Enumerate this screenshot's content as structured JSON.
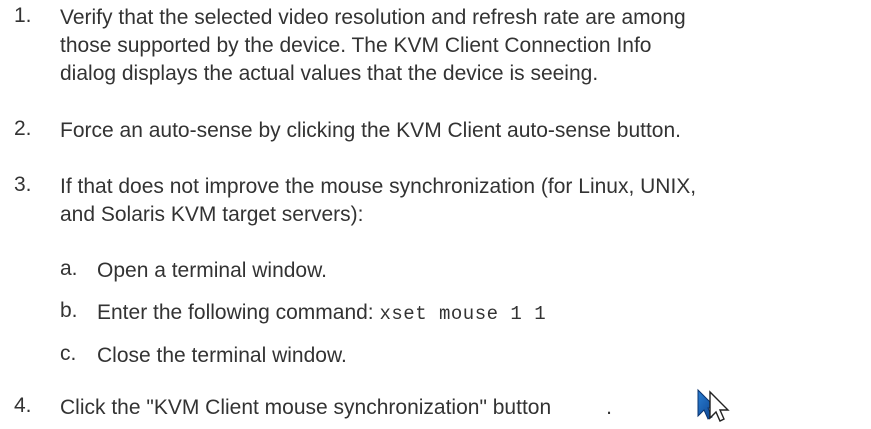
{
  "steps": [
    {
      "number": "1.",
      "lines": [
        "Verify that the selected video resolution and refresh rate are among",
        "those supported by the device. The KVM Client Connection Info",
        "dialog displays the actual values that the device is seeing."
      ]
    },
    {
      "number": "2.",
      "lines": [
        "Force an auto-sense by clicking the KVM Client auto-sense button."
      ]
    },
    {
      "number": "3.",
      "lines": [
        "If that does not improve the mouse synchronization (for Linux, UNIX,",
        "and Solaris KVM target servers):"
      ],
      "substeps": [
        {
          "letter": "a.",
          "text": "Open a terminal window."
        },
        {
          "letter": "b.",
          "text": "Enter the following command: ",
          "code": "xset mouse 1 1"
        },
        {
          "letter": "c.",
          "text": "Close the terminal window."
        }
      ]
    },
    {
      "number": "4.",
      "text": "Click the \"KVM Client mouse synchronization\" button",
      "trailing": ".",
      "icon": "mouse-sync-cursor-icon"
    }
  ]
}
